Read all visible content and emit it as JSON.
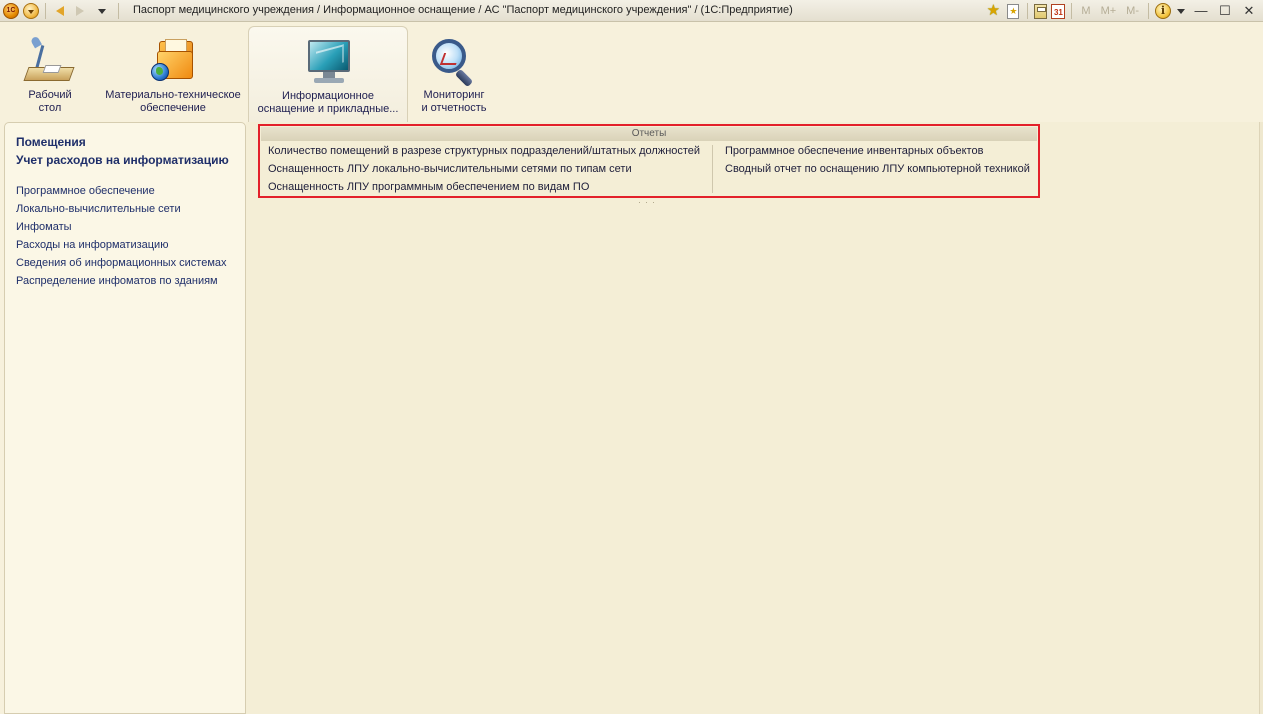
{
  "window": {
    "title": "Паспорт медицинского учреждения / Информационное оснащение / АС \"Паспорт медицинского учреждения\" /  (1С:Предприятие)",
    "memory_buttons": [
      "M",
      "M+",
      "M-"
    ]
  },
  "sections": [
    {
      "line1": "Рабочий",
      "line2": "стол",
      "icon": "desk-icon"
    },
    {
      "line1": "Материально-техническое",
      "line2": "обеспечение",
      "icon": "folder-globe-icon"
    },
    {
      "line1": "Информационное",
      "line2": "оснащение и прикладные...",
      "icon": "monitor-icon",
      "active": true
    },
    {
      "line1": "Мониторинг",
      "line2": "и отчетность",
      "icon": "magnifier-icon"
    }
  ],
  "sidebar": {
    "bold_items": [
      "Помещения",
      "Учет расходов на информатизацию"
    ],
    "items": [
      "Программное обеспечение",
      "Локально-вычислительные сети",
      "Инфоматы",
      "Расходы на информатизацию",
      "Сведения об информационных системах",
      "Распределение инфоматов по зданиям"
    ]
  },
  "reports": {
    "header": "Отчеты",
    "left": [
      "Количество помещений в разрезе структурных подразделений/штатных должностей",
      "Оснащенность ЛПУ локально-вычислительными сетями по типам сети",
      "Оснащенность ЛПУ программным обеспечением по видам ПО"
    ],
    "right": [
      "Программное обеспечение инвентарных объектов",
      "Сводный отчет по оснащению ЛПУ компьютерной техникой"
    ]
  },
  "colors": {
    "highlight_border": "#e3202a",
    "link": "#1f2f6a",
    "background": "#f7f1dc"
  }
}
